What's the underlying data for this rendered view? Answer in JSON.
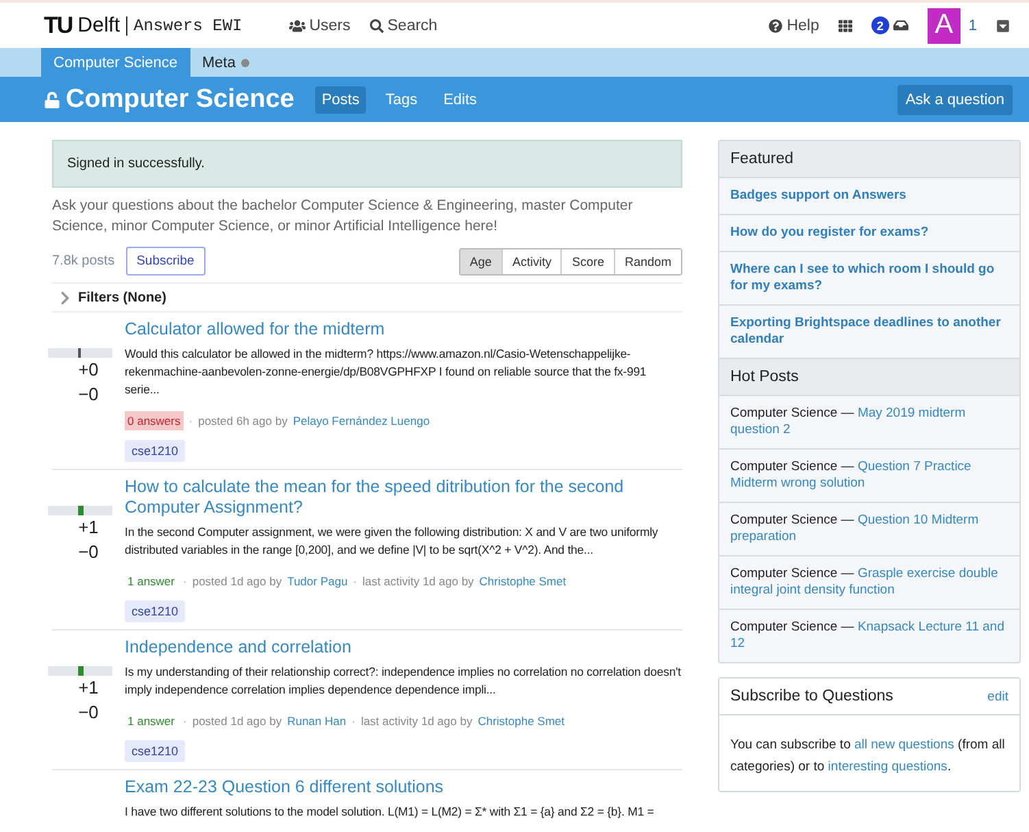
{
  "header": {
    "logo_mark": "TU",
    "logo_word": "Delft",
    "site_name": "Answers EWI",
    "nav": [
      {
        "kind": "users",
        "label": "Users"
      },
      {
        "kind": "search",
        "label": "Search"
      }
    ],
    "help": "Help",
    "inbox_count": "2",
    "avatar_letter": "A",
    "reputation": "1"
  },
  "category_tabs": [
    {
      "label": "Computer Science",
      "selected": true,
      "dot": false
    },
    {
      "label": "Meta",
      "selected": false,
      "dot": true
    }
  ],
  "category_bar": {
    "title": "Computer Science",
    "links": [
      {
        "label": "Posts",
        "selected": true
      },
      {
        "label": "Tags",
        "selected": false
      },
      {
        "label": "Edits",
        "selected": false
      }
    ],
    "ask_button": "Ask a question"
  },
  "alert": "Signed in successfully.",
  "description": "Ask your questions about the bachelor Computer Science & Engineering, master Computer Science, minor Computer Science, or minor Artificial Intelligence here!",
  "meta_separator": "·",
  "post_count": "7.8k posts",
  "subscribe_button": "Subscribe",
  "sort_buttons": [
    {
      "label": "Age",
      "selected": true
    },
    {
      "label": "Activity",
      "selected": false
    },
    {
      "label": "Score",
      "selected": false
    },
    {
      "label": "Random",
      "selected": false
    }
  ],
  "filters": {
    "label": "Filters (None)",
    "expanded": false
  },
  "posts": [
    {
      "title": "Calculator allowed for the midterm",
      "excerpt": "Would this calculator be allowed in the midterm? https://www.amazon.nl/Casio-Wetenschappelijke-rekenmachine-aanbevolen-zonne-energie/dp/B08VGPHFXP I found on reliable source that the fx-991 serie...",
      "upvotes": "+0",
      "downvotes": "−0",
      "level": 0.5,
      "voted": false,
      "answers": "0 answers",
      "answered": false,
      "posted": "posted 6h ago by",
      "author": "Pelayo Fernández Luengo",
      "tags": [
        "cse1210"
      ]
    },
    {
      "title": "How to calculate the mean for the speed ditribution for the second Computer Assignment?",
      "excerpt": "In the second Computer assignment, we were given the following distribution: X and V are two uniformly distributed variables in the range [0,200], and we define |V| to be sqrt(X^2 + V^2). And the...",
      "upvotes": "+1",
      "downvotes": "−0",
      "level": 0.5,
      "voted": true,
      "answers": "1 answer",
      "answered": true,
      "posted": "posted 1d ago by",
      "author": "Tudor Pagu",
      "activity": "last activity 1d ago by",
      "activity_author": "Christophe Smet",
      "tags": [
        "cse1210"
      ]
    },
    {
      "title": "Independence and correlation",
      "excerpt": "Is my understanding of their relationship correct?: independence implies no correlation no correlation doesn't imply independence correlation implies dependence dependence impli...",
      "upvotes": "+1",
      "downvotes": "−0",
      "level": 0.5,
      "voted": true,
      "answers": "1 answer",
      "answered": true,
      "posted": "posted 1d ago by",
      "author": "Runan Han",
      "activity": "last activity 1d ago by",
      "activity_author": "Christophe Smet",
      "tags": [
        "cse1210"
      ]
    },
    {
      "title": "Exam 22-23 Question 6 different solutions",
      "excerpt": "I have two different solutions to the model solution. L(M1) = L(M2) = Σ* with Σ1 = {a} and Σ2 = {b}. M1 ="
    }
  ],
  "featured": {
    "title": "Featured",
    "items": [
      "Badges support on Answers",
      "How do you register for exams?",
      "Where can I see to which room I should go for my exams?",
      "Exporting Brightspace deadlines to another calendar"
    ]
  },
  "hot_posts": {
    "title": "Hot Posts",
    "items": [
      {
        "category": "Computer Science —",
        "title": "May 2019 midterm question 2"
      },
      {
        "category": "Computer Science —",
        "title": "Question 7 Practice Midterm wrong solution"
      },
      {
        "category": "Computer Science —",
        "title": "Question 10 Midterm preparation"
      },
      {
        "category": "Computer Science —",
        "title": "Grasple exercise double integral joint density function"
      },
      {
        "category": "Computer Science —",
        "title": "Knapsack Lecture 11 and 12"
      }
    ]
  },
  "subscribe_card": {
    "title": "Subscribe to Questions",
    "edit": "edit",
    "text_before": "You can subscribe to",
    "link_1": "all new questions",
    "text_middle": "(from all categories) or to",
    "link_2": "interesting questions",
    "text_after": "."
  }
}
